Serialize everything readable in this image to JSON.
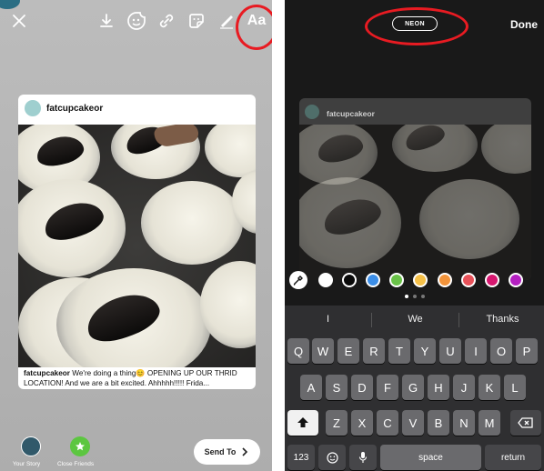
{
  "left_screen": {
    "toolbar": {
      "close_icon": "x-icon",
      "download_icon": "download-icon",
      "sticker_face_icon": "face-sticker-icon",
      "link_icon": "link-icon",
      "sticker_icon": "sticker-icon",
      "draw_icon": "pen-icon",
      "text_label": "Aa"
    },
    "post": {
      "username": "fatcupcakeor",
      "caption_user": "fatcupcakeor",
      "caption_text": " We're doing a thing😊 OPENING UP OUR THRID LOCATION! And we are a bit excited. Ahhhhh!!!!! Frida..."
    },
    "bottom": {
      "your_story_label": "Your Story",
      "close_friends_label": "Close Friends",
      "send_to_label": "Send To"
    }
  },
  "right_screen": {
    "style_label": "NEON",
    "done_label": "Done",
    "post_username": "fatcupcakeor",
    "colors": [
      "#ffffff",
      "#0a0a0a",
      "#3b8ee8",
      "#69c248",
      "#f5c048",
      "#f2933a",
      "#e8525a",
      "#d6176f",
      "#b41fc1"
    ],
    "keyboard": {
      "suggestions": [
        "I",
        "We",
        "Thanks"
      ],
      "row1": [
        "Q",
        "W",
        "E",
        "R",
        "T",
        "Y",
        "U",
        "I",
        "O",
        "P"
      ],
      "row2": [
        "A",
        "S",
        "D",
        "F",
        "G",
        "H",
        "J",
        "K",
        "L"
      ],
      "row3": [
        "Z",
        "X",
        "C",
        "V",
        "B",
        "N",
        "M"
      ],
      "numbers_label": "123",
      "space_label": "space",
      "return_label": "return"
    }
  },
  "annotation_color": "#e81b22"
}
